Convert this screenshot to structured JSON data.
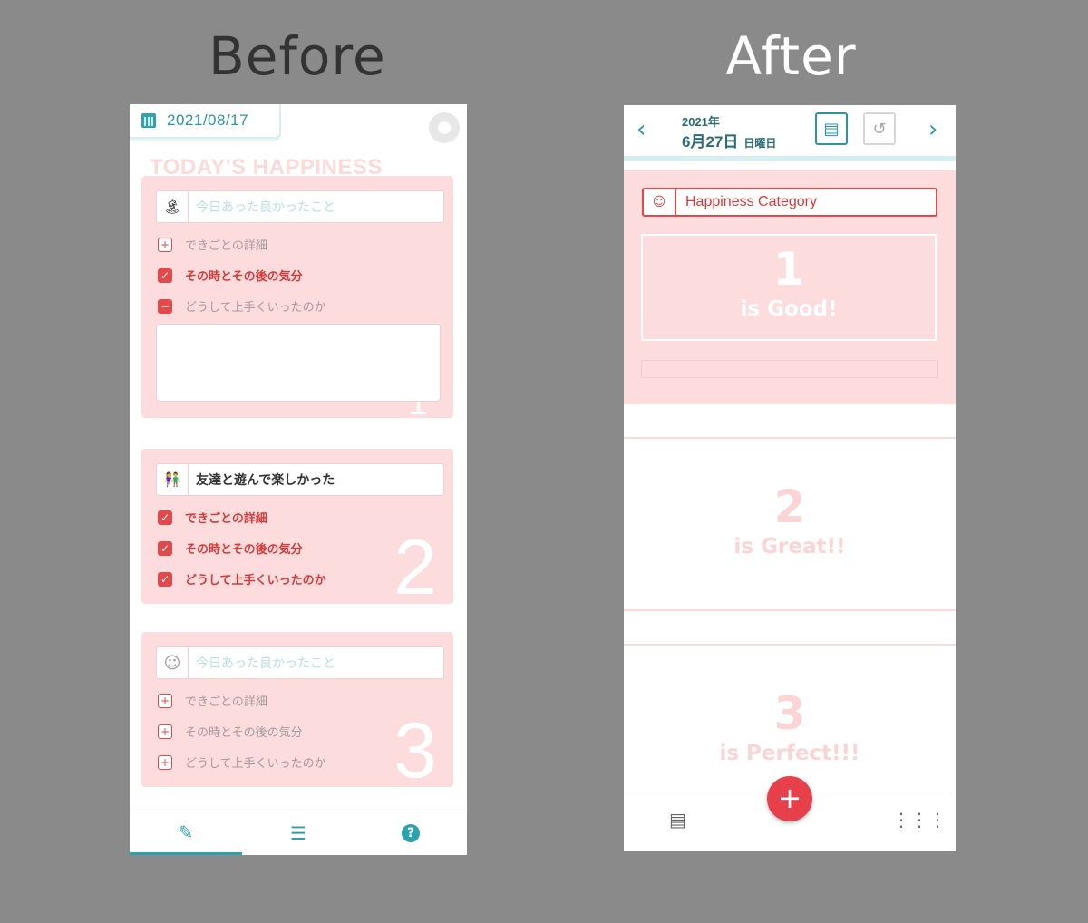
{
  "headings": {
    "before": "Before",
    "after": "After"
  },
  "before": {
    "date": "2021/08/17",
    "section_title": "TODAY'S HAPPINESS",
    "cards": [
      {
        "number": "1",
        "emoji": "🏝",
        "title": "今日あった良かったこと",
        "title_is_placeholder": true,
        "items": [
          {
            "label": "できごとの詳細",
            "state": "plus"
          },
          {
            "label": "その時とその後の気分",
            "state": "checked"
          },
          {
            "label": "どうして上手くいったのか",
            "state": "minus"
          }
        ]
      },
      {
        "number": "2",
        "emoji": "👫",
        "title": "友達と遊んで楽しかった",
        "title_is_placeholder": false,
        "items": [
          {
            "label": "できごとの詳細",
            "state": "checked"
          },
          {
            "label": "その時とその後の気分",
            "state": "checked"
          },
          {
            "label": "どうして上手くいったのか",
            "state": "checked"
          }
        ]
      },
      {
        "number": "3",
        "emoji": "☺",
        "title": "今日あった良かったこと",
        "title_is_placeholder": true,
        "items": [
          {
            "label": "できごとの詳細",
            "state": "plus"
          },
          {
            "label": "その時とその後の気分",
            "state": "plus"
          },
          {
            "label": "どうして上手くいったのか",
            "state": "plus"
          }
        ]
      }
    ],
    "nav": {
      "active": "edit-icon"
    }
  },
  "after": {
    "year": "2021年",
    "month_day": "6月27日",
    "weekday": "日曜日",
    "category_placeholder": "Happiness Category",
    "goals": [
      {
        "number": "1",
        "text": "is Good!"
      },
      {
        "number": "2",
        "text": "is Great!!"
      },
      {
        "number": "3",
        "text": "is Perfect!!!"
      }
    ],
    "fab_label": "+"
  },
  "colors": {
    "accent_teal": "#2a96a0",
    "accent_red": "#e04a4a",
    "card_pink": "#fcdcdc",
    "background": "#8a8a8a"
  }
}
